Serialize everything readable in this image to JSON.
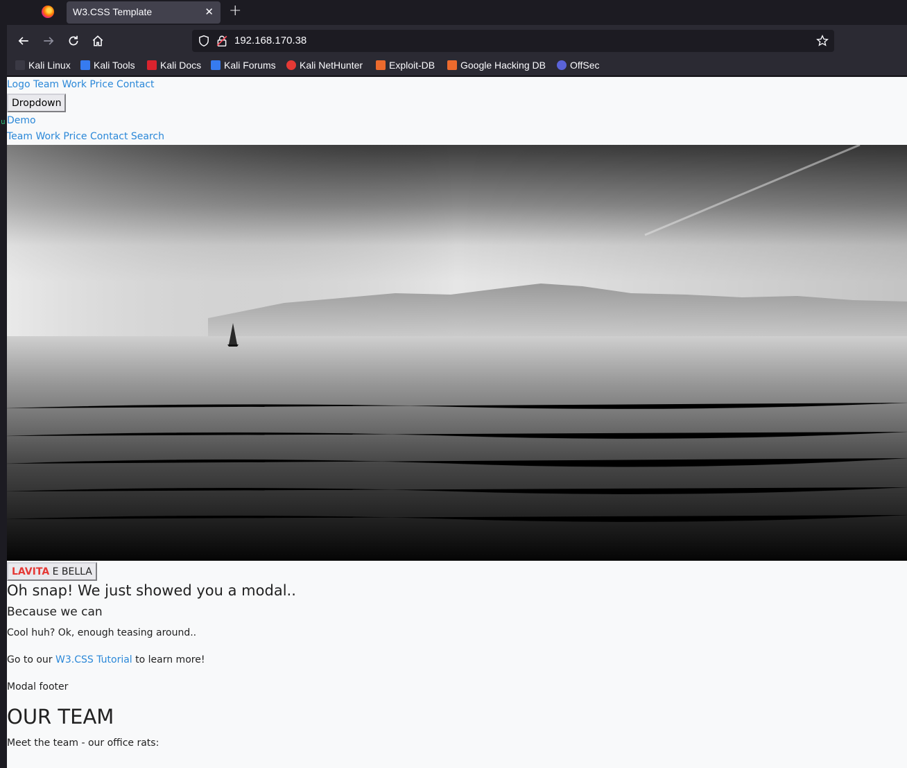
{
  "browser": {
    "tab_title": "W3.CSS Template",
    "url": "192.168.170.38",
    "bookmarks": [
      {
        "label": "Kali Linux",
        "icon": "kali-dragon-icon",
        "color": "#1c1b22"
      },
      {
        "label": "Kali Tools",
        "icon": "kali-tools-icon",
        "color": "#367bf0"
      },
      {
        "label": "Kali Docs",
        "icon": "kali-docs-icon",
        "color": "#d9232e"
      },
      {
        "label": "Kali Forums",
        "icon": "kali-forums-icon",
        "color": "#367bf0"
      },
      {
        "label": "Kali NetHunter",
        "icon": "kali-nethunter-icon",
        "color": "#e53935"
      },
      {
        "label": "Exploit-DB",
        "icon": "exploit-db-icon",
        "color": "#ec6a2d"
      },
      {
        "label": "Google Hacking DB",
        "icon": "ghdb-icon",
        "color": "#ec6a2d"
      },
      {
        "label": "OffSec",
        "icon": "offsec-icon",
        "color": "#5a63d8"
      }
    ]
  },
  "page": {
    "top_nav": [
      "Logo",
      "Team",
      "Work",
      "Price",
      "Contact"
    ],
    "dropdown_label": "Dropdown",
    "demo_label": "Demo",
    "second_nav": [
      "Team",
      "Work",
      "Price",
      "Contact",
      "Search"
    ],
    "brand": {
      "red": "LAVITA",
      "rest": " E BELLA"
    },
    "modal": {
      "heading": "Oh snap! We just showed you a modal..",
      "subheading": "Because we can",
      "text1": "Cool huh? Ok, enough teasing around..",
      "text2_prefix": "Go to our ",
      "text2_link": "W3.CSS Tutorial",
      "text2_suffix": " to learn more!",
      "footer": "Modal footer"
    },
    "team": {
      "heading": "OUR TEAM",
      "text": "Meet the team - our office rats:"
    },
    "colors": {
      "link": "#2b88d8",
      "brand_red": "#e53935"
    }
  }
}
